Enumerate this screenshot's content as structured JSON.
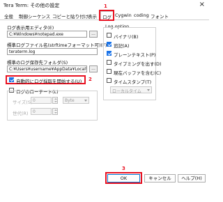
{
  "window": {
    "title": "Tera Term: その他の設定",
    "close_glyph": "×"
  },
  "tabs": [
    {
      "label": "全般"
    },
    {
      "label": "制御シーケンス"
    },
    {
      "label": "コピーと貼り付け"
    },
    {
      "label": "表示"
    },
    {
      "label": "ログ",
      "active": true
    },
    {
      "label": "Cygwin"
    },
    {
      "label": "coding"
    },
    {
      "label": "フォント"
    }
  ],
  "markers": {
    "m1": "1",
    "m2": "2",
    "m3": "3"
  },
  "log": {
    "editor_label": "ログ表示用エディタ(E)",
    "editor_value": "C:¥Windows¥notepad.exe",
    "filename_label": "標準ログファイル名(strftimeフォーマット可)(F)",
    "filename_value": "teraterm.log",
    "folder_label": "標準のログ保存先フォルダ(S)",
    "folder_value": "C:¥Users¥username¥AppData¥Local¥ter",
    "browse_label": "...",
    "autostart_label": "自動的にログ採取を開始する(U)",
    "autostart_checked": true,
    "rotate_label": "ログのローテート(L)",
    "size_label": "サイズ(S)",
    "size_value": "0",
    "size_unit": "Byte",
    "gen_label": "世代(R)",
    "gen_value": "0"
  },
  "log_option": {
    "title": "Log option",
    "items": [
      {
        "label": "バイナリ(B)",
        "checked": false
      },
      {
        "label": "追記(A)",
        "checked": true
      },
      {
        "label": "プレーンテキスト(P)",
        "checked": true
      },
      {
        "label": "タイプミングを出す(D)",
        "checked": false
      },
      {
        "label": "現在バッファを含む(C)",
        "checked": false
      },
      {
        "label": "タイムスタンプ(T)",
        "checked": false
      }
    ],
    "timestamp_select": "ローカルタイム"
  },
  "buttons": {
    "ok": "OK",
    "cancel": "キャンセル",
    "help": "ヘルプ(H)"
  }
}
